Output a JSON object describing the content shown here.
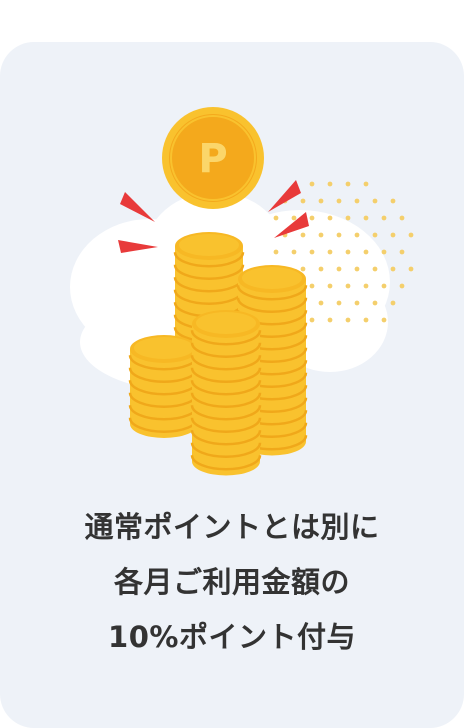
{
  "card": {
    "caption_line_1": "通常ポイントとは別に",
    "caption_line_2": "各月ご利用金額の",
    "caption_line_3": "10%ポイント付与",
    "coin_mark": "P"
  },
  "icons": {
    "illustration": "coin-stack-illustration-icon",
    "point_coin": "point-coin-icon"
  },
  "colors": {
    "card_background": "#eef2f8",
    "coin_gold": "#f9c22e",
    "coin_shade": "#f0a81a",
    "burst_red": "#e83a3a",
    "dots": "#f4cf6c",
    "text": "#333333"
  }
}
